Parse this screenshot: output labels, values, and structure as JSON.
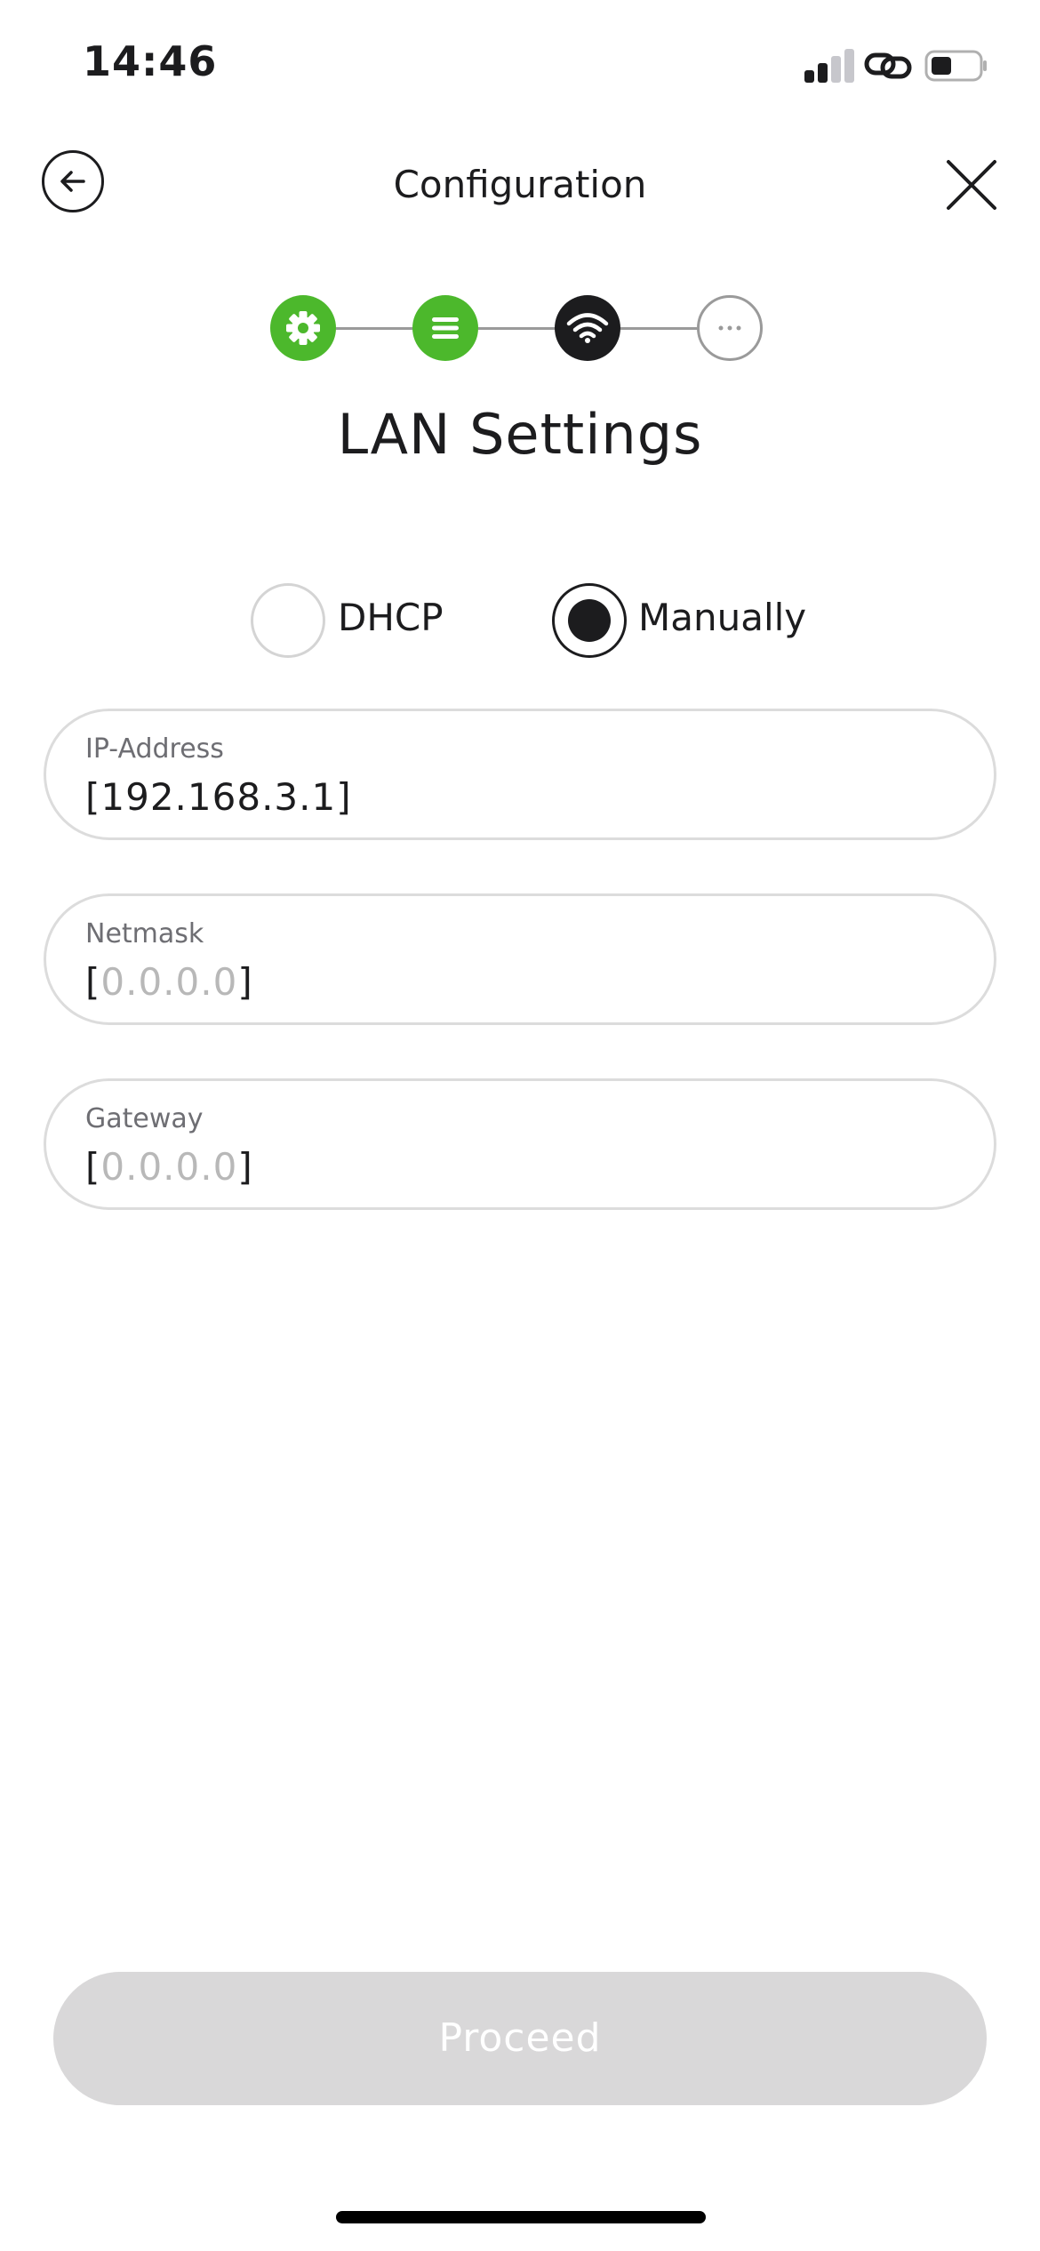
{
  "status_bar": {
    "time": "14:46"
  },
  "header": {
    "title": "Configuration"
  },
  "stepper": {
    "steps": [
      {
        "icon": "gear-icon",
        "state": "done",
        "color": "#4cb82c"
      },
      {
        "icon": "list-icon",
        "state": "done",
        "color": "#4cb82c"
      },
      {
        "icon": "wifi-icon",
        "state": "current",
        "color": "#1c1c1e"
      },
      {
        "icon": "more-icon",
        "state": "pending",
        "color": "#9a9a9a"
      }
    ]
  },
  "heading": "LAN Settings",
  "mode": {
    "options": [
      "DHCP",
      "Manually"
    ],
    "selected": "Manually"
  },
  "fields": {
    "ip": {
      "label": "IP-Address",
      "value": "192.168.3.1"
    },
    "netmask": {
      "label": "Netmask",
      "placeholder": "0.0.0.0"
    },
    "gateway": {
      "label": "Gateway",
      "placeholder": "0.0.0.0"
    }
  },
  "proceed_label": "Proceed",
  "colors": {
    "accent_green": "#4cb82c",
    "disabled_button": "#d9d8d9"
  }
}
